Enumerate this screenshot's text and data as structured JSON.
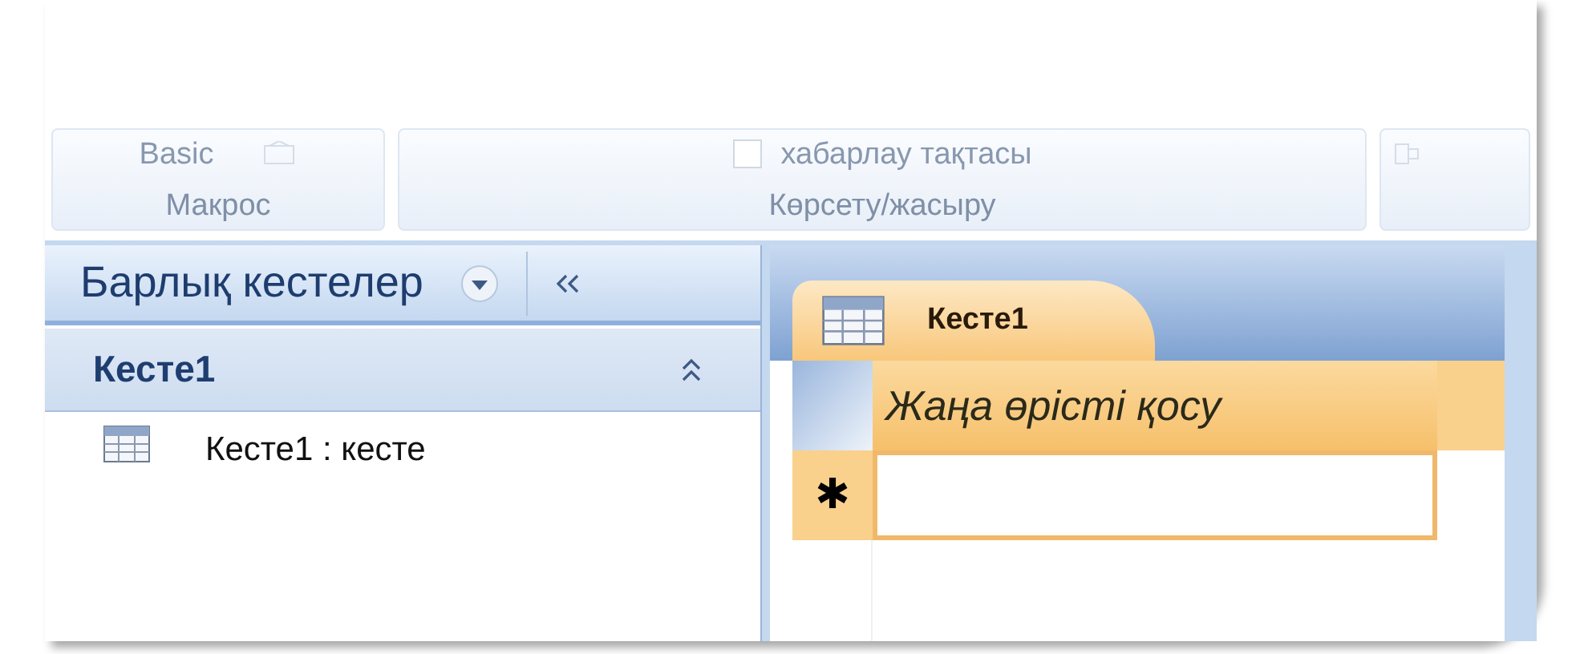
{
  "ribbon": {
    "groups": [
      {
        "label": "Макрос",
        "items": [
          {
            "kind": "button",
            "text": "Basic"
          }
        ]
      },
      {
        "label": "Көрсету/жасыру",
        "items": [
          {
            "kind": "checkbox",
            "text": "хабарлау тақтасы",
            "checked": false
          }
        ]
      }
    ]
  },
  "navigation_pane": {
    "title": "Барлық кестелер",
    "groups": [
      {
        "label": "Кесте1",
        "expanded": true,
        "items": [
          {
            "label": "Кесте1 : кесте"
          }
        ]
      }
    ]
  },
  "document_tabs": [
    {
      "label": "Кесте1",
      "selected": true
    }
  ],
  "datasheet": {
    "columns": [
      {
        "label": "Жаңа өрісті қосу"
      }
    ],
    "new_row_marker": "✱"
  }
}
